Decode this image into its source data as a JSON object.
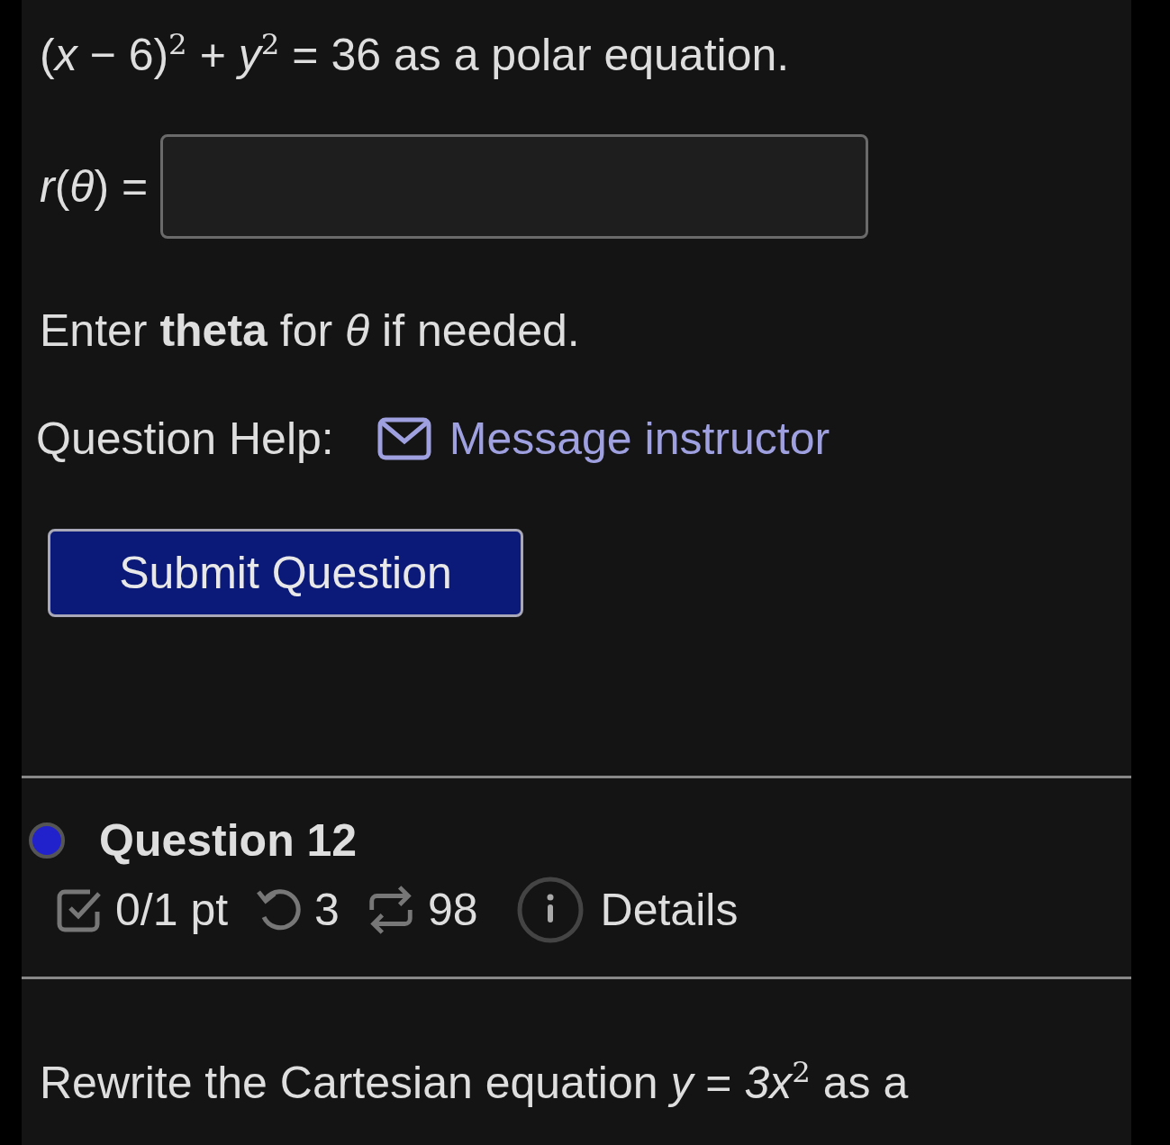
{
  "prompt": "(*x* − 6)$^{2}$ + *y*$^{2}$ = 36 as a polar equation.",
  "answer": {
    "label": "*r*(*θ*) ="
  },
  "hint": "Enter **theta** for *θ* if needed.",
  "help": {
    "label": "Question Help:",
    "link": "Message instructor"
  },
  "submit": "Submit Question",
  "next_question": {
    "title": "Question 12",
    "score": "0/1 pt",
    "retries": "3",
    "attempts": "98",
    "details": "Details"
  },
  "next_prompt": "Rewrite the Cartesian equation *y* = *3x*$^{2}$ as a"
}
